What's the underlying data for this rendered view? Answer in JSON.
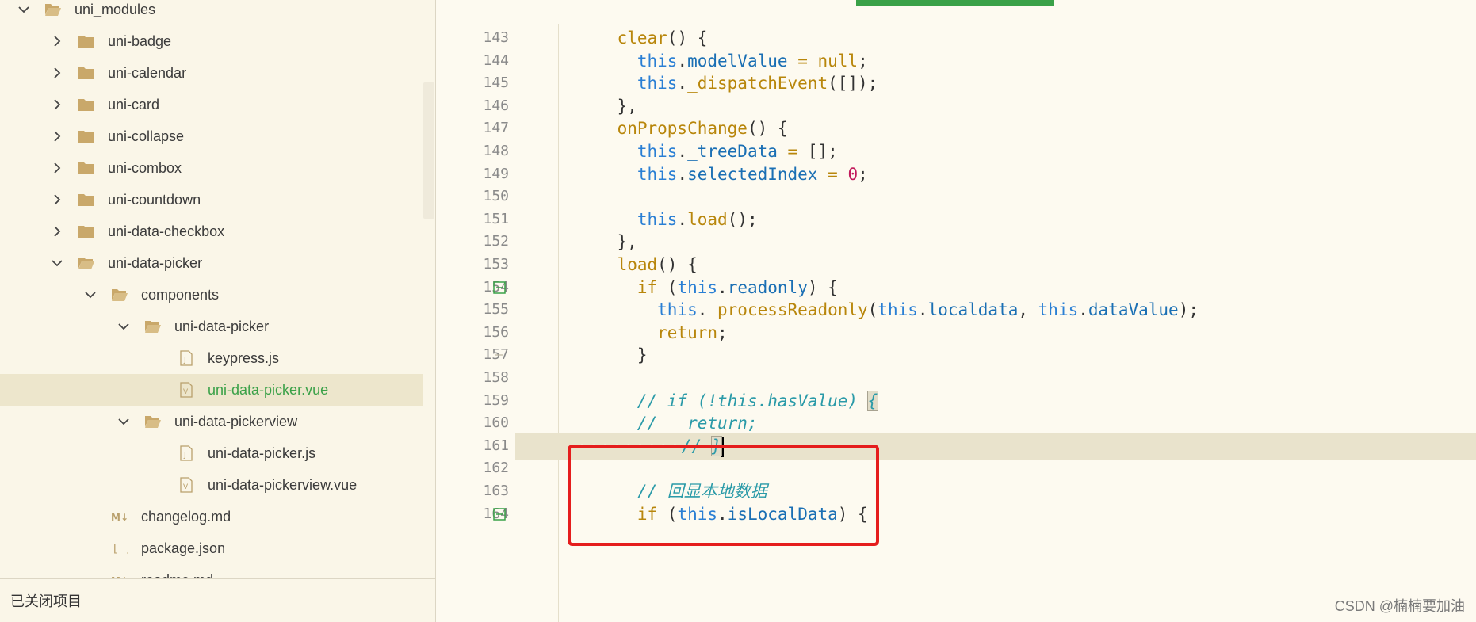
{
  "sidebar": {
    "items": [
      {
        "label": "uni_modules",
        "depth": 0,
        "kind": "folder",
        "expanded": true
      },
      {
        "label": "uni-badge",
        "depth": 1,
        "kind": "folder",
        "expanded": false
      },
      {
        "label": "uni-calendar",
        "depth": 1,
        "kind": "folder",
        "expanded": false
      },
      {
        "label": "uni-card",
        "depth": 1,
        "kind": "folder",
        "expanded": false
      },
      {
        "label": "uni-collapse",
        "depth": 1,
        "kind": "folder",
        "expanded": false
      },
      {
        "label": "uni-combox",
        "depth": 1,
        "kind": "folder",
        "expanded": false
      },
      {
        "label": "uni-countdown",
        "depth": 1,
        "kind": "folder",
        "expanded": false
      },
      {
        "label": "uni-data-checkbox",
        "depth": 1,
        "kind": "folder",
        "expanded": false
      },
      {
        "label": "uni-data-picker",
        "depth": 1,
        "kind": "folder",
        "expanded": true
      },
      {
        "label": "components",
        "depth": 2,
        "kind": "folder",
        "expanded": true
      },
      {
        "label": "uni-data-picker",
        "depth": 3,
        "kind": "folder",
        "expanded": true
      },
      {
        "label": "keypress.js",
        "depth": 4,
        "kind": "js"
      },
      {
        "label": "uni-data-picker.vue",
        "depth": 4,
        "kind": "vue",
        "selected": true
      },
      {
        "label": "uni-data-pickerview",
        "depth": 3,
        "kind": "folder",
        "expanded": true
      },
      {
        "label": "uni-data-picker.js",
        "depth": 4,
        "kind": "js"
      },
      {
        "label": "uni-data-pickerview.vue",
        "depth": 4,
        "kind": "vue"
      },
      {
        "label": "changelog.md",
        "depth": 2,
        "kind": "md"
      },
      {
        "label": "package.json",
        "depth": 2,
        "kind": "json"
      },
      {
        "label": "readme.md",
        "depth": 2,
        "kind": "md"
      }
    ],
    "footer_label": "已关闭项目"
  },
  "editor": {
    "lines": [
      {
        "n": "143",
        "code": [
          [
            "fn",
            "    clear"
          ],
          [
            "pu",
            "() {"
          ]
        ]
      },
      {
        "n": "144",
        "code": [
          [
            "kw",
            "      this"
          ],
          [
            "pu",
            "."
          ],
          [
            "nl",
            "modelValue"
          ],
          [
            "pu",
            " "
          ],
          [
            "fn",
            "="
          ],
          [
            "pu",
            " "
          ],
          [
            "fn",
            "null"
          ],
          [
            "pu",
            ";"
          ]
        ]
      },
      {
        "n": "145",
        "code": [
          [
            "kw",
            "      this"
          ],
          [
            "pu",
            "."
          ],
          [
            "fn",
            "_dispatchEvent"
          ],
          [
            "pu",
            "([]);"
          ]
        ]
      },
      {
        "n": "146",
        "code": [
          [
            "pu",
            "    },"
          ]
        ]
      },
      {
        "n": "147",
        "code": [
          [
            "fn",
            "    onPropsChange"
          ],
          [
            "pu",
            "() {"
          ]
        ]
      },
      {
        "n": "148",
        "code": [
          [
            "kw",
            "      this"
          ],
          [
            "pu",
            "."
          ],
          [
            "nl",
            "_treeData"
          ],
          [
            "pu",
            " "
          ],
          [
            "fn",
            "="
          ],
          [
            "pu",
            " [];"
          ]
        ]
      },
      {
        "n": "149",
        "code": [
          [
            "kw",
            "      this"
          ],
          [
            "pu",
            "."
          ],
          [
            "nl",
            "selectedIndex"
          ],
          [
            "pu",
            " "
          ],
          [
            "fn",
            "="
          ],
          [
            "pu",
            " "
          ],
          [
            "nu",
            "0"
          ],
          [
            "pu",
            ";"
          ]
        ]
      },
      {
        "n": "150",
        "code": []
      },
      {
        "n": "151",
        "code": [
          [
            "kw",
            "      this"
          ],
          [
            "pu",
            "."
          ],
          [
            "fn",
            "load"
          ],
          [
            "pu",
            "();"
          ]
        ]
      },
      {
        "n": "152",
        "code": [
          [
            "pu",
            "    },"
          ]
        ]
      },
      {
        "n": "153",
        "code": [
          [
            "fn",
            "    load"
          ],
          [
            "pu",
            "() {"
          ]
        ]
      },
      {
        "n": "154",
        "code": [
          [
            "fn",
            "      if"
          ],
          [
            "pu",
            " ("
          ],
          [
            "kw",
            "this"
          ],
          [
            "pu",
            "."
          ],
          [
            "nl",
            "readonly"
          ],
          [
            "pu",
            ") {"
          ]
        ],
        "fold": "minus"
      },
      {
        "n": "155",
        "code": [
          [
            "kw",
            "        this"
          ],
          [
            "pu",
            "."
          ],
          [
            "fn",
            "_processReadonly"
          ],
          [
            "pu",
            "("
          ],
          [
            "kw",
            "this"
          ],
          [
            "pu",
            "."
          ],
          [
            "nl",
            "localdata"
          ],
          [
            "pu",
            ", "
          ],
          [
            "kw",
            "this"
          ],
          [
            "pu",
            "."
          ],
          [
            "nl",
            "dataValue"
          ],
          [
            "pu",
            ");"
          ]
        ]
      },
      {
        "n": "156",
        "code": [
          [
            "fn",
            "        return"
          ],
          [
            "pu",
            ";"
          ]
        ]
      },
      {
        "n": "157",
        "code": [
          [
            "pu",
            "      }"
          ]
        ],
        "fold": "end"
      },
      {
        "n": "158",
        "code": []
      },
      {
        "n": "159",
        "code": [
          [
            "cm",
            "      // if (!this.hasValue) "
          ],
          [
            "hl",
            "{"
          ]
        ]
      },
      {
        "n": "160",
        "code": [
          [
            "cm",
            "      //   return;"
          ]
        ]
      },
      {
        "n": "161",
        "code": [
          [
            "dots",
            "·········"
          ],
          [
            "cm",
            "// "
          ],
          [
            "hl",
            "}"
          ],
          [
            "caret",
            ""
          ]
        ],
        "current": true
      },
      {
        "n": "162",
        "code": []
      },
      {
        "n": "163",
        "code": [
          [
            "cm",
            "      // 回显本地数据"
          ]
        ]
      },
      {
        "n": "164",
        "code": [
          [
            "fn",
            "      if"
          ],
          [
            "pu",
            " ("
          ],
          [
            "kw",
            "this"
          ],
          [
            "pu",
            "."
          ],
          [
            "nl",
            "isLocalData"
          ],
          [
            "pu",
            ") {"
          ]
        ],
        "fold": "minus"
      }
    ]
  },
  "watermark": "CSDN @楠楠要加油",
  "colors": {
    "accent": "#3aa148",
    "highlight_box": "#e51d1d",
    "background": "#fdfaf0"
  }
}
